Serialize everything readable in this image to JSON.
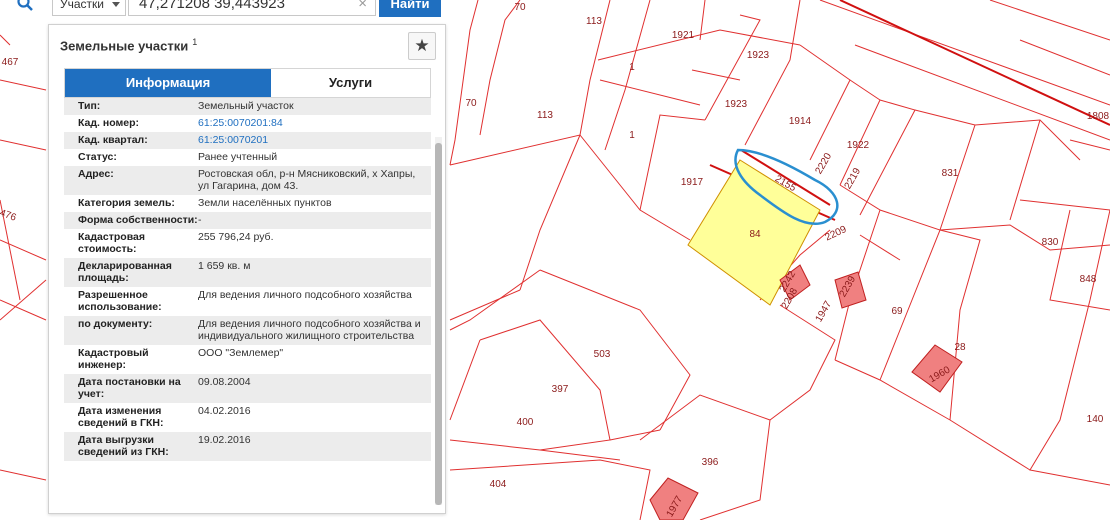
{
  "search": {
    "type_label": "Участки",
    "query": "47,271208 39,443923",
    "clear_symbol": "×",
    "find_label": "Найти"
  },
  "panel": {
    "title": "Земельные участки",
    "title_count": "1",
    "tabs": {
      "info": "Информация",
      "services": "Услуги"
    },
    "rows": [
      {
        "key": "Тип:",
        "value": "Земельный участок"
      },
      {
        "key": "Кад. номер:",
        "value": "61:25:0070201:84",
        "link": true
      },
      {
        "key": "Кад. квартал:",
        "value": "61:25:0070201",
        "link": true
      },
      {
        "key": "Статус:",
        "value": "Ранее учтенный"
      },
      {
        "key": "Адрес:",
        "value": "Ростовская обл, р-н Мясниковский, х Хапры, ул Гагарина, дом 43."
      },
      {
        "key": "Категория земель:",
        "value": "Земли населённых пунктов"
      },
      {
        "key": "Форма собственности:",
        "value": "-"
      },
      {
        "key": "Кадастровая стоимость:",
        "value": "255 796,24 руб."
      },
      {
        "key": "Декларированная площадь:",
        "value": "1 659 кв. м"
      },
      {
        "key": "Разрешенное использование:",
        "value": "Для ведения личного подсобного хозяйства"
      },
      {
        "key": "по документу:",
        "value": "Для ведения личного подсобного хозяйства и индивидуального жилищного строительства"
      },
      {
        "key": "Кадастровый инженер:",
        "value": "ООО \"Землемер\""
      },
      {
        "key": "Дата постановки на учет:",
        "value": "09.08.2004"
      },
      {
        "key": "Дата изменения сведений в ГКН:",
        "value": "04.02.2016"
      },
      {
        "key": "Дата выгрузки сведений из ГКН:",
        "value": "19.02.2016"
      }
    ]
  },
  "map": {
    "parcel_labels": [
      "70",
      "113",
      "1921",
      "1923",
      "1",
      "1923",
      "1914",
      "70",
      "113",
      "1",
      "1808",
      "2220",
      "1922",
      "1917",
      "2155",
      "2219",
      "831",
      "467",
      "84",
      "2209",
      "830",
      "848",
      "476",
      "2242",
      "2208",
      "2239",
      "1947",
      "69",
      "503",
      "28",
      "1960",
      "397",
      "400",
      "140",
      "396",
      "404",
      "1977"
    ],
    "colors": {
      "boundary": "#e02020",
      "selected_fill": "#ffff99",
      "building_fill": "#f08080",
      "annotation": "#2a8fd0",
      "label": "#8b1a1a"
    }
  }
}
